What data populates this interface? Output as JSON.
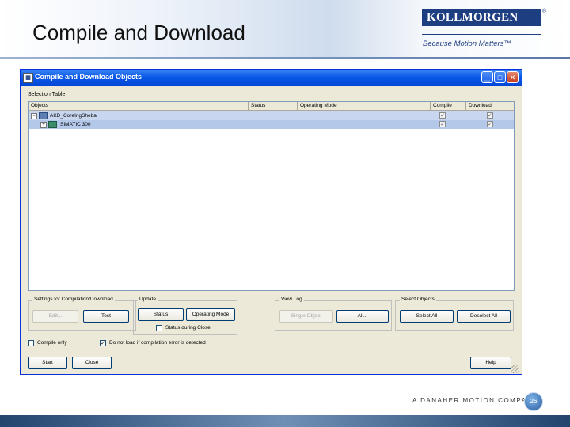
{
  "slide": {
    "title": "Compile and Download",
    "logo_text": "KOLLMORGEN",
    "logo_reg": "®",
    "tagline": "Because Motion Matters™",
    "footer_text": "A DANAHER MOTION COMPANY",
    "page_number": "26"
  },
  "colors": {
    "brand_blue": "#1e3e82",
    "titlebar_blue": "#0a58e8",
    "dialog_bg": "#ece9d8",
    "selection_blue": "#b4c8ea"
  },
  "dialog": {
    "title": "Compile and Download Objects",
    "title_icon": "compile-window-icon",
    "minimize_icon": "minimize-icon",
    "maximize_icon": "maximize-icon",
    "close_icon": "close-icon",
    "selection_table_label": "Selection Table",
    "columns": [
      "Objects",
      "Status",
      "Operating Mode",
      "Compile",
      "Download"
    ],
    "rows": [
      {
        "expander": "−",
        "icon": "station-icon",
        "name": "AKD_CoreIngShebal",
        "compile": true,
        "download": true
      },
      {
        "expander": "+",
        "icon": "plc-icon",
        "name": "SIMATIC 300",
        "compile": true,
        "download": true
      }
    ],
    "settings_group": {
      "title": "Settings for Compilation/Download",
      "edit_label": "Edit...",
      "test_label": "Test"
    },
    "update_group": {
      "title": "Update",
      "status_label": "Status",
      "operating_mode_label": "Operating Mode",
      "status_during_close_label": "Status during Close"
    },
    "view_log_group": {
      "title": "View Log",
      "single_object_label": "Single Object",
      "all_label": "All..."
    },
    "select_objects_group": {
      "title": "Select Objects",
      "select_all_label": "Select All",
      "deselect_all_label": "Deselect All"
    },
    "compile_only_label": "Compile only",
    "do_not_load_label": "Do not load if compilation error is detected",
    "do_not_load_checked": true,
    "start_label": "Start",
    "close_label": "Close",
    "help_label": "Help"
  }
}
